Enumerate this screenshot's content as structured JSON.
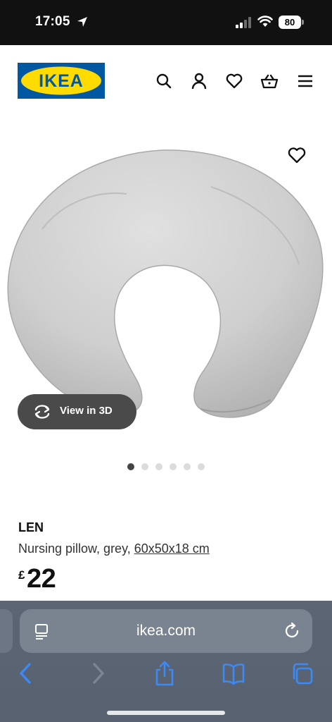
{
  "status_bar": {
    "time": "17:05",
    "battery": "80"
  },
  "header": {
    "logo_text": "IKEA",
    "colors": {
      "logo_blue": "#0058a3",
      "logo_yellow": "#ffdb00"
    },
    "icons": [
      "search-icon",
      "account-icon",
      "favourites-icon",
      "basket-icon",
      "menu-icon"
    ]
  },
  "product": {
    "image_alt_icon": "nursing-pillow-image",
    "view_3d_label": "View in 3D",
    "carousel": {
      "count": 6,
      "active_index": 0
    },
    "name": "LEN",
    "description": "Nursing pillow, grey, ",
    "measurement": "60x50x18 cm",
    "currency_symbol": "£",
    "price": "22"
  },
  "browser": {
    "url": "ikea.com",
    "toolbar_icons": [
      "back-icon",
      "forward-icon",
      "share-icon",
      "bookmarks-icon",
      "tabs-icon"
    ],
    "accent": "#3a8af7"
  }
}
